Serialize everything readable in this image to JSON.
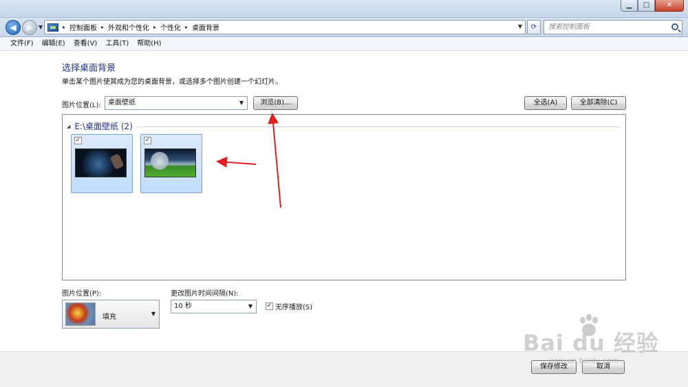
{
  "window": {
    "minimize": "▁",
    "maximize": "□",
    "close": "✕"
  },
  "address": {
    "breadcrumbs": [
      "控制面板",
      "外观和个性化",
      "个性化",
      "桌面背景"
    ],
    "search_placeholder": "搜索控制面板"
  },
  "menu": [
    "文件(F)",
    "编辑(E)",
    "查看(V)",
    "工具(T)",
    "帮助(H)"
  ],
  "page": {
    "title": "选择桌面背景",
    "description": "单击某个图片使其成为您的桌面背景，或选择多个图片创建一个幻灯片。"
  },
  "location": {
    "label": "图片位置(L):",
    "value": "桌面壁纸",
    "browse": "浏览(B)...",
    "select_all": "全选(A)",
    "clear_all": "全部清除(C)"
  },
  "gallery": {
    "group_title": "E:\\桌面壁纸 (2)",
    "items": [
      {
        "checked": "✓",
        "image": "space-wallpaper"
      },
      {
        "checked": "✓",
        "image": "planet-field-wallpaper"
      }
    ]
  },
  "position": {
    "label": "图片位置(P):",
    "value": "填充"
  },
  "interval": {
    "label": "更改图片时间间隔(N):",
    "value": "10 秒"
  },
  "shuffle": {
    "checked": "✓",
    "label": "无序播放(S)"
  },
  "footer": {
    "save": "保存修改",
    "cancel": "取消"
  },
  "watermark": {
    "text": "Bai du 经验",
    "sub": "jingyan.baidu.com"
  },
  "colors": {
    "annotation": "#e02020",
    "title_blue": "#1e3287"
  }
}
